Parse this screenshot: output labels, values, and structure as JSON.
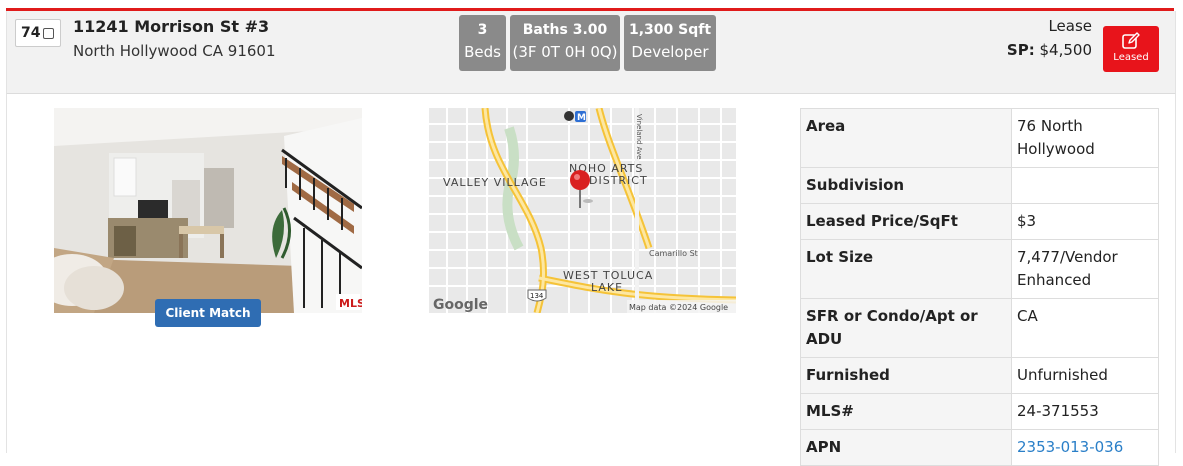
{
  "listing": {
    "number": "74",
    "street": "11241 Morrison St #3",
    "city_line": "North Hollywood CA 91601",
    "beds_value": "3",
    "beds_label": "Beds",
    "baths_value": "Baths 3.00",
    "baths_detail": "(3F 0T 0H 0Q)",
    "sqft_value": "1,300 Sqft",
    "sqft_source": "Developer",
    "lease_type": "Lease",
    "sp_label": "SP:",
    "sp_value": "$4,500",
    "status_button": "Leased",
    "client_match": "Client Match"
  },
  "map": {
    "labels": {
      "noho1": "NOHO ARTS",
      "noho2": "DISTRICT",
      "valley": "VALLEY VILLAGE",
      "westtoluca1": "WEST TOLUCA",
      "westtoluca2": "LAKE",
      "camarillo": "Camarillo St",
      "vineland": "Vineland Ave",
      "shield": "134",
      "metro": "M",
      "attribution": "Map data ©2024 Google",
      "logo": "Google"
    }
  },
  "details": [
    {
      "key": "Area",
      "value": "76 North Hollywood"
    },
    {
      "key": "Subdivision",
      "value": ""
    },
    {
      "key": "Leased Price/SqFt",
      "value": "$3"
    },
    {
      "key": "Lot Size",
      "value": "7,477/Vendor Enhanced"
    },
    {
      "key": "SFR or Condo/Apt or ADU",
      "value": "CA"
    },
    {
      "key": "Furnished",
      "value": "Unfurnished"
    },
    {
      "key": "MLS#",
      "value": "24-371553"
    },
    {
      "key": "APN",
      "value": "2353-013-036"
    }
  ],
  "colors": {
    "accent_red": "#e8141b",
    "button_blue": "#2f6db3",
    "link_blue": "#2a7fc8",
    "stat_gray": "#8a8a8a"
  },
  "icons": [
    "edit-icon",
    "map-pin-icon",
    "metro-icon",
    "highway-shield-icon"
  ]
}
